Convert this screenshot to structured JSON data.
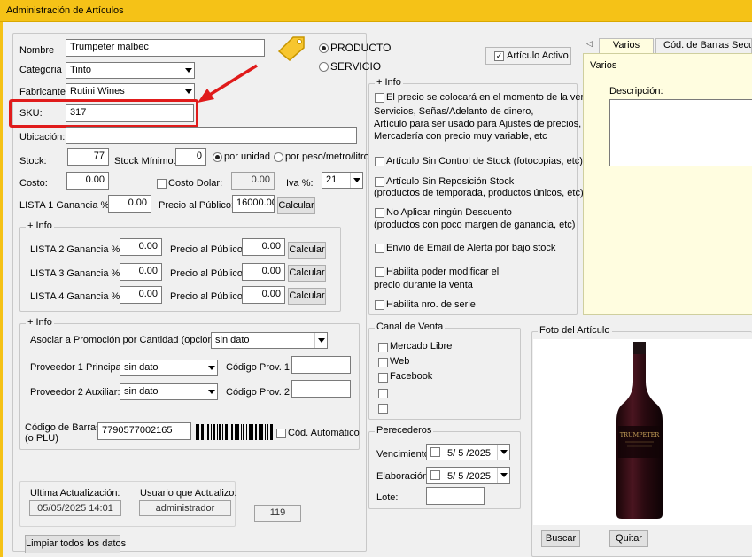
{
  "window": {
    "title": "Administración de Artículos"
  },
  "form": {
    "nombre_label": "Nombre",
    "nombre_value": "Trumpeter malbec",
    "categoria_label": "Categoria",
    "categoria_value": "Tinto",
    "fabricante_label": "Fabricante",
    "fabricante_value": "Rutini Wines",
    "sku_label": "SKU:",
    "sku_value": "317",
    "ubicacion_label": "Ubicación:",
    "ubicacion_value": "",
    "stock_label": "Stock:",
    "stock_value": "77",
    "stock_min_label": "Stock Mínimo:",
    "stock_min_value": "0",
    "por_unidad_label": "por unidad",
    "por_peso_label": "por peso/metro/litro",
    "costo_label": "Costo:",
    "costo_value": "0.00",
    "costo_dolar_label": "Costo Dolar:",
    "costo_dolar_value": "0.00",
    "iva_label": "Iva %:",
    "iva_value": "21",
    "lista1_label": "LISTA 1 Ganancia %:",
    "lista1_value": "0.00",
    "precio_publico_label": "Precio al Público:",
    "precio1_value": "16000.00",
    "calcular_label": "Calcular",
    "producto_label": "PRODUCTO",
    "servicio_label": "SERVICIO",
    "articulo_activo_label": "Artículo Activo"
  },
  "listas": {
    "title": "+ Info",
    "rows": [
      {
        "label": "LISTA 2 Ganancia %:",
        "ganancia": "0.00",
        "precio": "0.00"
      },
      {
        "label": "LISTA 3 Ganancia %:",
        "ganancia": "0.00",
        "precio": "0.00"
      },
      {
        "label": "LISTA 4 Ganancia %:",
        "ganancia": "0.00",
        "precio": "0.00"
      }
    ]
  },
  "info2": {
    "title": "+ Info",
    "promocion_label": "Asociar a Promoción por Cantidad (opcional):",
    "promocion_value": "sin dato",
    "prov1_label": "Proveedor 1 Principal:",
    "prov1_value": "sin dato",
    "cod_prov1_label": "Código Prov. 1:",
    "prov2_label": "Proveedor 2 Auxiliar:",
    "prov2_value": "sin dato",
    "cod_prov2_label": "Código Prov. 2:",
    "codbarras_label_1": "Código de Barras:",
    "codbarras_label_2": "(o PLU)",
    "codbarras_value": "7790577002165",
    "cod_automatico_label": "Cód. Automático"
  },
  "info_options": {
    "title": "+ Info",
    "precio_momento": "El precio se colocará en el momento de la venta",
    "precio_momento_desc": [
      "Servicios, Señas/Adelanto de dinero,",
      "Artículo para ser usado para Ajustes de precios,",
      "Mercadería con precio muy variable, etc"
    ],
    "sin_control_stock": "Artículo Sin Control de Stock (fotocopias, etc)",
    "sin_reposicion": "Artículo Sin Reposición Stock",
    "sin_reposicion_desc": "(productos de temporada, productos únicos, etc)",
    "no_descuento": "No Aplicar ningún Descuento",
    "no_descuento_desc": "(productos con poco margen de ganancia, etc)",
    "email_alerta": "Envio de Email de Alerta por bajo stock",
    "modificar_precio": "Habilita poder modificar el",
    "modificar_precio_desc": "precio durante la venta",
    "nro_serie": "Habilita nro. de serie"
  },
  "canal_venta": {
    "title": "Canal de Venta",
    "items": [
      "Mercado Libre",
      "Web",
      "Facebook",
      "",
      ""
    ]
  },
  "perecederos": {
    "title": "Perecederos",
    "vencimiento_label": "Vencimiento:",
    "vencimiento_value": "5/ 5 /2025",
    "elaboracion_label": "Elaboración:",
    "elaboracion_value": "5/ 5 /2025",
    "lote_label": "Lote:",
    "lote_value": ""
  },
  "tabs": {
    "items": [
      "Varios",
      "Cód. de Barras Secundarios"
    ],
    "active_title": "Varios",
    "descripcion_label": "Descripción:"
  },
  "foto": {
    "title": "Foto del Artículo",
    "buscar_label": "Buscar",
    "quitar_label": "Quitar",
    "bottle_label_text": "TRUMPETER"
  },
  "footer": {
    "ultima_act_label": "Ultima Actualización:",
    "ultima_act_value": "05/05/2025 14:01",
    "usuario_label": "Usuario que Actualizo:",
    "usuario_value": "administrador",
    "id_value": "119",
    "limpiar_label": "Limpiar todos los datos"
  },
  "colors": {
    "titlebar": "#f5c217",
    "highlight": "#e01b1b",
    "tab_active": "#fffde0"
  }
}
